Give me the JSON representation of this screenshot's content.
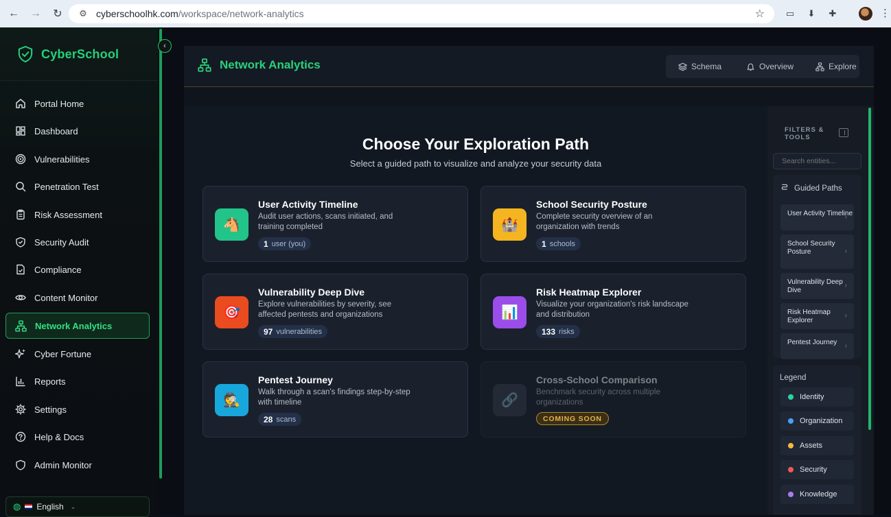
{
  "browser": {
    "url_host": "cyberschoolhk.com",
    "url_path": "/workspace/network-analytics"
  },
  "sidebar": {
    "brand": "CyberSchool",
    "items": [
      {
        "label": "Portal Home",
        "icon": "home-icon"
      },
      {
        "label": "Dashboard",
        "icon": "dashboard-icon"
      },
      {
        "label": "Vulnerabilities",
        "icon": "target-icon"
      },
      {
        "label": "Penetration Test",
        "icon": "search-icon"
      },
      {
        "label": "Risk Assessment",
        "icon": "clipboard-icon"
      },
      {
        "label": "Security Audit",
        "icon": "shield-check-icon"
      },
      {
        "label": "Compliance",
        "icon": "file-check-icon"
      },
      {
        "label": "Content Monitor",
        "icon": "eye-icon"
      },
      {
        "label": "Network Analytics",
        "icon": "network-icon",
        "active": true
      },
      {
        "label": "Cyber Fortune",
        "icon": "sparkles-icon"
      },
      {
        "label": "Reports",
        "icon": "bar-chart-icon"
      },
      {
        "label": "Settings",
        "icon": "gear-icon"
      },
      {
        "label": "Help & Docs",
        "icon": "help-icon"
      },
      {
        "label": "Admin Monitor",
        "icon": "shield-icon"
      }
    ],
    "language": "English"
  },
  "header": {
    "title": "Network Analytics",
    "views": [
      {
        "label": "Schema",
        "icon": "layers-icon"
      },
      {
        "label": "Overview",
        "icon": "bell-icon"
      },
      {
        "label": "Explore",
        "icon": "network-icon"
      }
    ]
  },
  "main": {
    "heading": "Choose Your Exploration Path",
    "subheading": "Select a guided path to visualize and analyze your security data",
    "cards": [
      {
        "title": "User Activity Timeline",
        "desc": "Audit user actions, scans initiated, and training completed",
        "count": "1",
        "unit": "user (you)",
        "emoji": "🐴",
        "color": "#22c48a"
      },
      {
        "title": "School Security Posture",
        "desc": "Complete security overview of an organization with trends",
        "count": "1",
        "unit": "schools",
        "emoji": "🏰",
        "color": "#f5b520"
      },
      {
        "title": "Vulnerability Deep Dive",
        "desc": "Explore vulnerabilities by severity, see affected pentests and organizations",
        "count": "97",
        "unit": "vulnerabilities",
        "emoji": "🎯",
        "color": "#ea4b1f"
      },
      {
        "title": "Risk Heatmap Explorer",
        "desc": "Visualize your organization's risk landscape and distribution",
        "count": "133",
        "unit": "risks",
        "emoji": "📊",
        "color": "#9b4dea"
      },
      {
        "title": "Pentest Journey",
        "desc": "Walk through a scan's findings step-by-step with timeline",
        "count": "28",
        "unit": "scans",
        "emoji": "🕵",
        "color": "#18a7dc"
      },
      {
        "title": "Cross-School Comparison",
        "desc": "Benchmark security across multiple organizations",
        "badge": "COMING SOON",
        "emoji": "🔗"
      }
    ]
  },
  "panel": {
    "title": "FILTERS & TOOLS",
    "search_placeholder": "Search entities...",
    "guided_title": "Guided Paths",
    "guided": [
      "User Activity Timeline",
      "School Security Posture",
      "Vulnerability Deep Dive",
      "Risk Heatmap Explorer",
      "Pentest Journey"
    ],
    "legend_title": "Legend",
    "legend": [
      {
        "label": "Identity",
        "color": "#2dd4a0"
      },
      {
        "label": "Organization",
        "color": "#4a9ff5"
      },
      {
        "label": "Assets",
        "color": "#f5b840"
      },
      {
        "label": "Security",
        "color": "#f05757"
      },
      {
        "label": "Knowledge",
        "color": "#a87cf0"
      }
    ]
  }
}
